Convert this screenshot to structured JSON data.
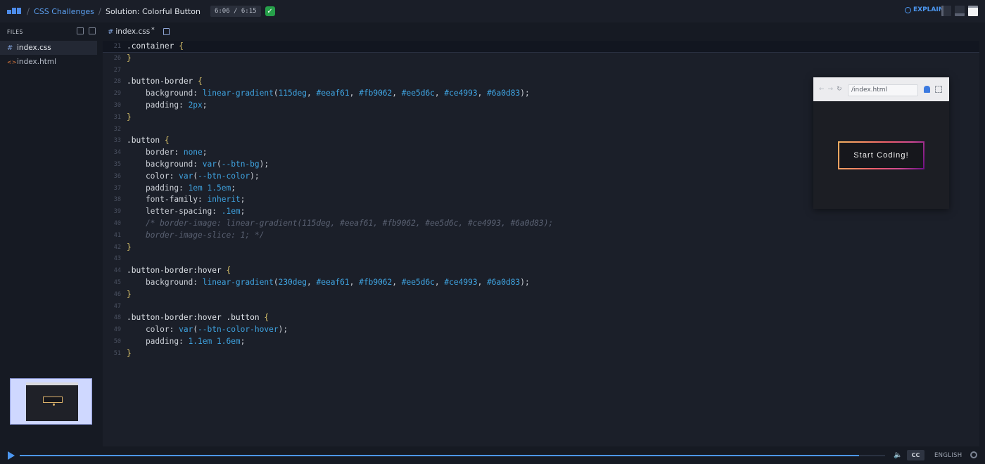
{
  "topbar": {
    "breadcrumb_parent": "CSS Challenges",
    "title": "Solution: Colorful Button",
    "time": "6:06 / 6:15",
    "explain_label": "EXPLAIN",
    "check_icon": "check-icon"
  },
  "sidebar": {
    "header": "FILES",
    "files": [
      {
        "icon": "#",
        "name": "index.css"
      },
      {
        "icon": "<>",
        "name": "index.html"
      }
    ]
  },
  "editor": {
    "tab_icon": "#",
    "tab_name": "index.css",
    "tab_modified": "*",
    "lines": [
      {
        "n": "21",
        "tokens": [
          [
            "sel",
            ".container "
          ],
          [
            "brace",
            "{"
          ]
        ]
      },
      {
        "n": "26",
        "tokens": [
          [
            "brace",
            "}"
          ]
        ]
      },
      {
        "n": "27",
        "tokens": []
      },
      {
        "n": "28",
        "tokens": [
          [
            "sel",
            ".button-border "
          ],
          [
            "brace",
            "{"
          ]
        ]
      },
      {
        "n": "29",
        "tokens": [
          [
            "prop",
            "    background: "
          ],
          [
            "val",
            "linear-gradient"
          ],
          [
            "prop",
            "("
          ],
          [
            "val",
            "115deg"
          ],
          [
            "prop",
            ", "
          ],
          [
            "val",
            "#eeaf61"
          ],
          [
            "prop",
            ", "
          ],
          [
            "val",
            "#fb9062"
          ],
          [
            "prop",
            ", "
          ],
          [
            "val",
            "#ee5d6c"
          ],
          [
            "prop",
            ", "
          ],
          [
            "val",
            "#ce4993"
          ],
          [
            "prop",
            ", "
          ],
          [
            "val",
            "#6a0d83"
          ],
          [
            "prop",
            ");"
          ]
        ]
      },
      {
        "n": "30",
        "tokens": [
          [
            "prop",
            "    padding: "
          ],
          [
            "val",
            "2px"
          ],
          [
            "prop",
            ";"
          ]
        ]
      },
      {
        "n": "31",
        "tokens": [
          [
            "brace",
            "}"
          ]
        ]
      },
      {
        "n": "32",
        "tokens": []
      },
      {
        "n": "33",
        "tokens": [
          [
            "sel",
            ".button "
          ],
          [
            "brace",
            "{"
          ]
        ]
      },
      {
        "n": "34",
        "tokens": [
          [
            "prop",
            "    border: "
          ],
          [
            "val",
            "none"
          ],
          [
            "prop",
            ";"
          ]
        ]
      },
      {
        "n": "35",
        "tokens": [
          [
            "prop",
            "    background: "
          ],
          [
            "val",
            "var"
          ],
          [
            "prop",
            "("
          ],
          [
            "val",
            "--btn-bg"
          ],
          [
            "prop",
            ");"
          ]
        ]
      },
      {
        "n": "36",
        "tokens": [
          [
            "prop",
            "    color: "
          ],
          [
            "val",
            "var"
          ],
          [
            "prop",
            "("
          ],
          [
            "val",
            "--btn-color"
          ],
          [
            "prop",
            ");"
          ]
        ]
      },
      {
        "n": "37",
        "tokens": [
          [
            "prop",
            "    padding: "
          ],
          [
            "val",
            "1em 1.5em"
          ],
          [
            "prop",
            ";"
          ]
        ]
      },
      {
        "n": "38",
        "tokens": [
          [
            "prop",
            "    font-family: "
          ],
          [
            "val",
            "inherit"
          ],
          [
            "prop",
            ";"
          ]
        ]
      },
      {
        "n": "39",
        "tokens": [
          [
            "prop",
            "    letter-spacing: "
          ],
          [
            "val",
            ".1em"
          ],
          [
            "prop",
            ";"
          ]
        ]
      },
      {
        "n": "40",
        "tokens": [
          [
            "cmt",
            "    /* border-image: linear-gradient(115deg, #eeaf61, #fb9062, #ee5d6c, #ce4993, #6a0d83);"
          ]
        ]
      },
      {
        "n": "41",
        "tokens": [
          [
            "cmt",
            "    border-image-slice: 1; */"
          ]
        ]
      },
      {
        "n": "42",
        "tokens": [
          [
            "brace",
            "}"
          ]
        ]
      },
      {
        "n": "43",
        "tokens": []
      },
      {
        "n": "44",
        "tokens": [
          [
            "sel",
            ".button-border:hover "
          ],
          [
            "brace",
            "{"
          ]
        ]
      },
      {
        "n": "45",
        "tokens": [
          [
            "prop",
            "    background: "
          ],
          [
            "val",
            "linear-gradient"
          ],
          [
            "prop",
            "("
          ],
          [
            "val",
            "230deg"
          ],
          [
            "prop",
            ", "
          ],
          [
            "val",
            "#eeaf61"
          ],
          [
            "prop",
            ", "
          ],
          [
            "val",
            "#fb9062"
          ],
          [
            "prop",
            ", "
          ],
          [
            "val",
            "#ee5d6c"
          ],
          [
            "prop",
            ", "
          ],
          [
            "val",
            "#ce4993"
          ],
          [
            "prop",
            ", "
          ],
          [
            "val",
            "#6a0d83"
          ],
          [
            "prop",
            ");"
          ]
        ]
      },
      {
        "n": "46",
        "tokens": [
          [
            "brace",
            "}"
          ]
        ]
      },
      {
        "n": "47",
        "tokens": []
      },
      {
        "n": "48",
        "tokens": [
          [
            "sel",
            ".button-border:hover .button "
          ],
          [
            "brace",
            "{"
          ]
        ]
      },
      {
        "n": "49",
        "tokens": [
          [
            "prop",
            "    color: "
          ],
          [
            "val",
            "var"
          ],
          [
            "prop",
            "("
          ],
          [
            "val",
            "--btn-color-hover"
          ],
          [
            "prop",
            ");"
          ]
        ]
      },
      {
        "n": "50",
        "tokens": [
          [
            "prop",
            "    padding: "
          ],
          [
            "val",
            "1.1em 1.6em"
          ],
          [
            "prop",
            ";"
          ]
        ]
      },
      {
        "n": "51",
        "tokens": [
          [
            "brace",
            "}"
          ]
        ]
      }
    ]
  },
  "preview": {
    "url": "/index.html",
    "button_label": "Start Coding!"
  },
  "player": {
    "progress": 0.97,
    "cc_label": "CC",
    "language": "ENGLISH"
  },
  "colors": {
    "accent": "#4c97f0",
    "success": "#26a04a"
  }
}
